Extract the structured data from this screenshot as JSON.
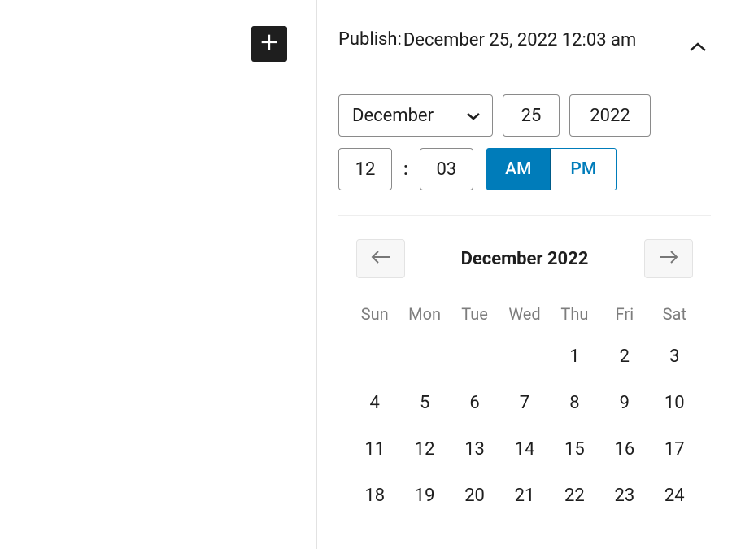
{
  "publish": {
    "label": "Publish:",
    "datetime": "December 25, 2022 12:03 am"
  },
  "inputs": {
    "month": "December",
    "day": "25",
    "year": "2022",
    "hour": "12",
    "minute": "03",
    "colon": ":",
    "am": "AM",
    "pm": "PM",
    "ampm_active": "AM"
  },
  "calendar": {
    "title": "December 2022",
    "dow": [
      "Sun",
      "Mon",
      "Tue",
      "Wed",
      "Thu",
      "Fri",
      "Sat"
    ],
    "lead_empty": 4,
    "days": [
      1,
      2,
      3,
      4,
      5,
      6,
      7,
      8,
      9,
      10,
      11,
      12,
      13,
      14,
      15,
      16,
      17,
      18,
      19,
      20,
      21,
      22,
      23,
      24
    ]
  }
}
